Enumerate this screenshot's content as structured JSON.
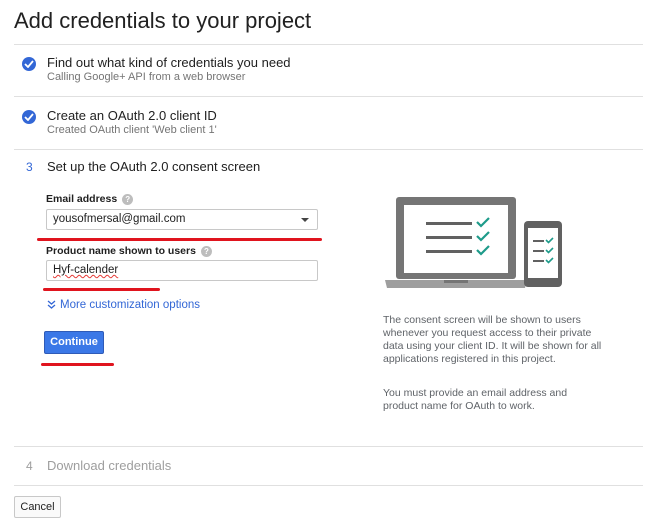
{
  "page": {
    "title": "Add credentials to your project"
  },
  "steps": [
    {
      "title": "Find out what kind of credentials you need",
      "subtitle": "Calling Google+ API from a web browser"
    },
    {
      "title": "Create an OAuth 2.0 client ID",
      "subtitle": "Created OAuth client 'Web client 1'"
    },
    {
      "number": "3",
      "title": "Set up the OAuth 2.0 consent screen"
    },
    {
      "number": "4",
      "title": "Download credentials"
    }
  ],
  "form": {
    "email_label": "Email address",
    "email_value": "yousofmersal@gmail.com",
    "product_label": "Product name shown to users",
    "product_value": "Hyf-calender",
    "more_options": "More customization options",
    "continue_label": "Continue",
    "help_glyph": "?"
  },
  "info": {
    "paragraph1": "The consent screen will be shown to users whenever you request access to their private data using your client ID. It will be shown for all applications registered in this project.",
    "paragraph2": "You must provide an email address and product name for OAuth to work."
  },
  "footer": {
    "cancel_label": "Cancel"
  },
  "colors": {
    "accent": "#3367d6",
    "button": "#3b78e7",
    "annotation": "#e0141e"
  }
}
